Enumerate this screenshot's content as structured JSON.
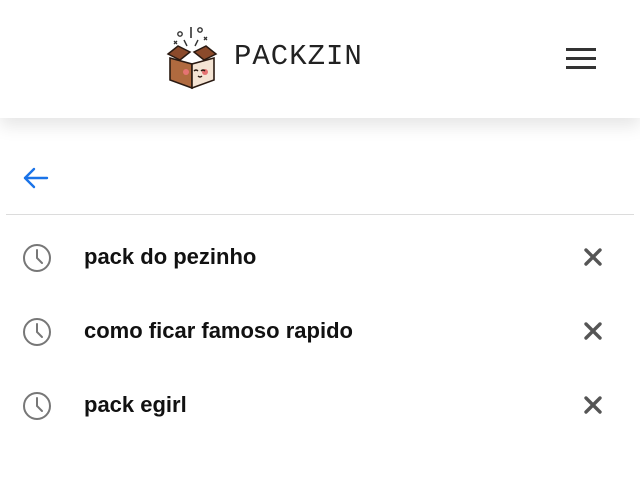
{
  "header": {
    "brand": "PACKZIN",
    "logo_icon": "box-logo-icon",
    "menu_icon": "hamburger-menu-icon"
  },
  "navigation": {
    "back_icon": "arrow-left-icon",
    "accent_color": "#1a73e8"
  },
  "history": {
    "item_icon": "clock-icon",
    "remove_icon": "close-icon",
    "items": [
      {
        "label": "pack do pezinho"
      },
      {
        "label": "como ficar famoso rapido"
      },
      {
        "label": "pack egirl"
      }
    ]
  },
  "colors": {
    "text": "#111111",
    "icon_gray": "#777777",
    "close_gray": "#555555",
    "divider": "#dcdcdc"
  }
}
